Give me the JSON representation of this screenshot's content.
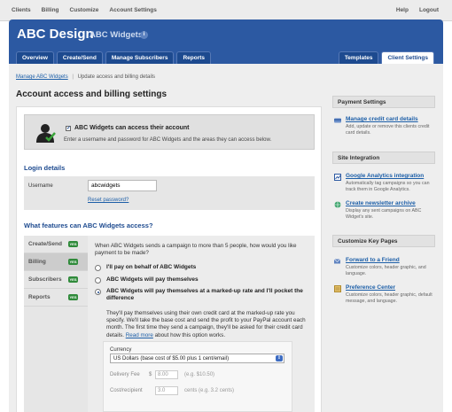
{
  "topnav": {
    "items": [
      "Clients",
      "Billing",
      "Customize",
      "Account Settings"
    ],
    "right": [
      "Help",
      "Logout"
    ]
  },
  "header": {
    "brand": "ABC Design",
    "client_name": "ABC Widgets",
    "info_icon": "i",
    "tabs": [
      "Overview",
      "Create/Send",
      "Manage Subscribers",
      "Reports"
    ],
    "tabs_right": [
      "Templates",
      "Client Settings"
    ],
    "active_tab": "Client Settings",
    "color": "#2c59a2"
  },
  "breadcrumb": {
    "link": "Manage ABC Widgets",
    "separator": "|",
    "current": "Update access and billing details"
  },
  "page_title": "Account access and billing settings",
  "access": {
    "checked": true,
    "label": "ABC Widgets can access their account",
    "description": "Enter a username and password for ABC Widgets and the areas they can access below."
  },
  "login": {
    "title": "Login details",
    "username_label": "Username",
    "username_value": "abcwidgets",
    "reset_link": "Reset password?"
  },
  "features": {
    "title": "What features can ABC Widgets access?",
    "nav": [
      {
        "label": "Create/Send",
        "badge": "YES"
      },
      {
        "label": "Billing",
        "badge": "YES"
      },
      {
        "label": "Subscribers",
        "badge": "YES"
      },
      {
        "label": "Reports",
        "badge": "YES"
      }
    ],
    "selected": "Billing",
    "intro": "When ABC Widgets sends a campaign to more than 5 people, how would you like payment to be made?",
    "options": [
      "I'll pay on behalf of ABC Widgets",
      "ABC Widgets will pay themselves",
      "ABC Widgets will pay themselves at a marked-up rate and I'll pocket the difference"
    ],
    "selected_option": 2,
    "explanation": "They'll pay themselves using their own credit card at the marked-up rate you specify. We'll take the base cost and send the profit to your PayPal account each month. The first time they send a campaign, they'll be asked for their credit card details.",
    "read_more": "Read more",
    "explanation_tail": "about how this option works.",
    "currency_label": "Currency",
    "currency_value": "US Dollars (base cost of $5.00 plus 1 cent/email)",
    "delivery_fee_label": "Delivery Fee",
    "currency_symbol": "$",
    "delivery_fee_value": "8.00",
    "delivery_fee_example": "(e.g. $10.50)",
    "cost_recipient_label": "Cost/recipient",
    "cost_recipient_value": "3.0",
    "cost_recipient_example": "cents (e.g. 3.2 cents)",
    "badge_color": "#2f8a3a"
  },
  "sidebar": {
    "payment": {
      "title": "Payment Settings",
      "items": [
        {
          "icon": "credit-card-icon",
          "link": "Manage credit card details",
          "desc": "Add, update or remove this clients credit card details."
        }
      ]
    },
    "integration": {
      "title": "Site Integration",
      "items": [
        {
          "icon": "analytics-icon",
          "link": "Google Analytics integration",
          "desc": "Automatically tag campaigns so you can track them in Google Analytics."
        },
        {
          "icon": "globe-icon",
          "link": "Create newsletter archive",
          "desc": "Display any sent campaigns on ABC Widget's site."
        }
      ]
    },
    "customize": {
      "title": "Customize Key Pages",
      "items": [
        {
          "icon": "forward-icon",
          "link": "Forward to a Friend",
          "desc": "Customize colors, header graphic, and language."
        },
        {
          "icon": "preferences-icon",
          "link": "Preference Center",
          "desc": "Customize colors, header graphic, default message, and language."
        }
      ]
    }
  }
}
